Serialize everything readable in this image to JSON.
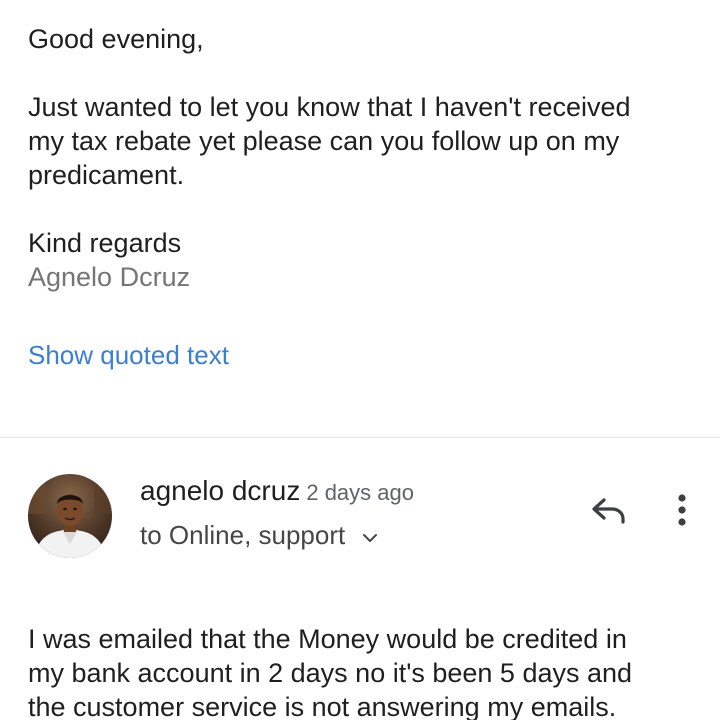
{
  "first_message": {
    "greeting": "Good evening,",
    "body_lines": [
      "Just wanted to let you know that I haven't received",
      "my tax rebate yet please can you follow up on my",
      "predicament."
    ],
    "closing": "Kind regards",
    "signature": "Agnelo Dcruz",
    "show_quoted_text": "Show quoted text"
  },
  "second_message": {
    "sender_name": "agnelo dcruz",
    "sent_time": "2 days ago",
    "recipients": "to Online, support",
    "icons": {
      "avatar": "avatar-photo",
      "reply": "reply-icon",
      "more": "more-vert-icon",
      "expand": "chevron-down-icon"
    },
    "body_lines": [
      "I was emailed that the Money would be credited in",
      "my bank account in 2 days no it's been 5 days and",
      "the customer service is not answering my emails."
    ]
  },
  "colors": {
    "link": "#3a7fd5",
    "text": "#1f1f1f",
    "muted": "#757575"
  }
}
